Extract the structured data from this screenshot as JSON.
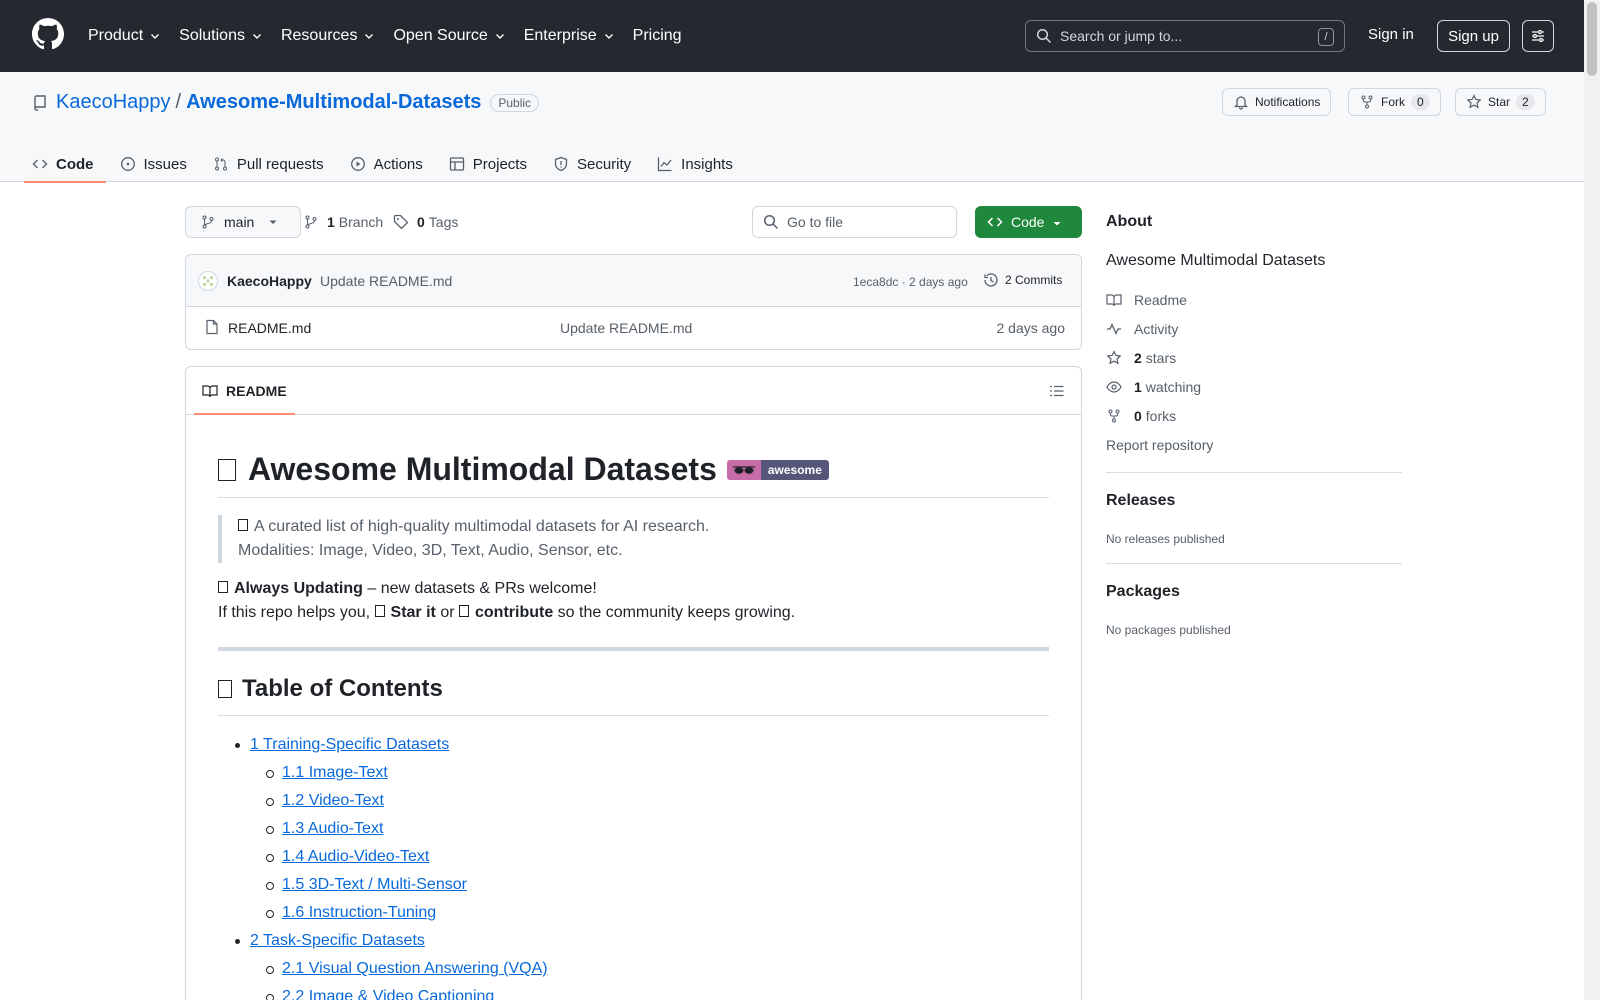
{
  "header": {
    "nav": [
      "Product",
      "Solutions",
      "Resources",
      "Open Source",
      "Enterprise",
      "Pricing"
    ],
    "search_placeholder": "Search or jump to...",
    "search_key": "/",
    "sign_in": "Sign in",
    "sign_up": "Sign up"
  },
  "repo": {
    "owner": "KaecoHappy",
    "separator": "/",
    "name": "Awesome-Multimodal-Datasets",
    "visibility": "Public",
    "notifications_label": "Notifications",
    "fork_label": "Fork",
    "fork_count": "0",
    "star_label": "Star",
    "star_count": "2",
    "tabs": [
      "Code",
      "Issues",
      "Pull requests",
      "Actions",
      "Projects",
      "Security",
      "Insights"
    ]
  },
  "toolbar": {
    "branch": "main",
    "branch_count": "1",
    "branch_label": "Branch",
    "tag_count": "0",
    "tag_label": "Tags",
    "goto_placeholder": "Go to file",
    "code_label": "Code"
  },
  "commit": {
    "author": "KaecoHappy",
    "message": "Update README.md",
    "sha_time": "1eca8dc · 2 days ago",
    "commits": "2 Commits"
  },
  "files": [
    {
      "name": "README.md",
      "message": "Update README.md",
      "time": "2 days ago"
    }
  ],
  "readme": {
    "tab_label": "README",
    "title": "Awesome Multimodal Datasets",
    "badge_text": "awesome",
    "quote_line1": "A curated list of high-quality multimodal datasets for AI research.",
    "quote_line2": "Modalities: Image, Video, 3D, Text, Audio, Sensor, etc.",
    "always_updating": "Always Updating",
    "always_rest": " – new datasets & PRs welcome!",
    "helps_prefix": "If this repo helps you, ",
    "star_it": "Star it",
    "or": " or ",
    "contribute": "contribute",
    "helps_suffix": " so the community keeps growing.",
    "toc_title": "Table of Contents",
    "toc": [
      {
        "level": 1,
        "label": "1 Training-Specific Datasets"
      },
      {
        "level": 2,
        "label": "1.1 Image-Text"
      },
      {
        "level": 2,
        "label": "1.2 Video-Text"
      },
      {
        "level": 2,
        "label": "1.3 Audio-Text"
      },
      {
        "level": 2,
        "label": "1.4 Audio-Video-Text"
      },
      {
        "level": 2,
        "label": "1.5 3D-Text / Multi-Sensor"
      },
      {
        "level": 2,
        "label": "1.6 Instruction-Tuning"
      },
      {
        "level": 1,
        "label": "2 Task-Specific Datasets"
      },
      {
        "level": 2,
        "label": "2.1 Visual Question Answering (VQA)"
      },
      {
        "level": 2,
        "label": "2.2 Image & Video Captioning"
      }
    ]
  },
  "sidebar": {
    "about_title": "About",
    "about_desc": "Awesome Multimodal Datasets",
    "readme": "Readme",
    "activity": "Activity",
    "stars_count": "2",
    "stars_label": "stars",
    "watching_count": "1",
    "watching_label": "watching",
    "forks_count": "0",
    "forks_label": "forks",
    "report": "Report repository",
    "releases_title": "Releases",
    "releases_empty": "No releases published",
    "packages_title": "Packages",
    "packages_empty": "No packages published"
  }
}
